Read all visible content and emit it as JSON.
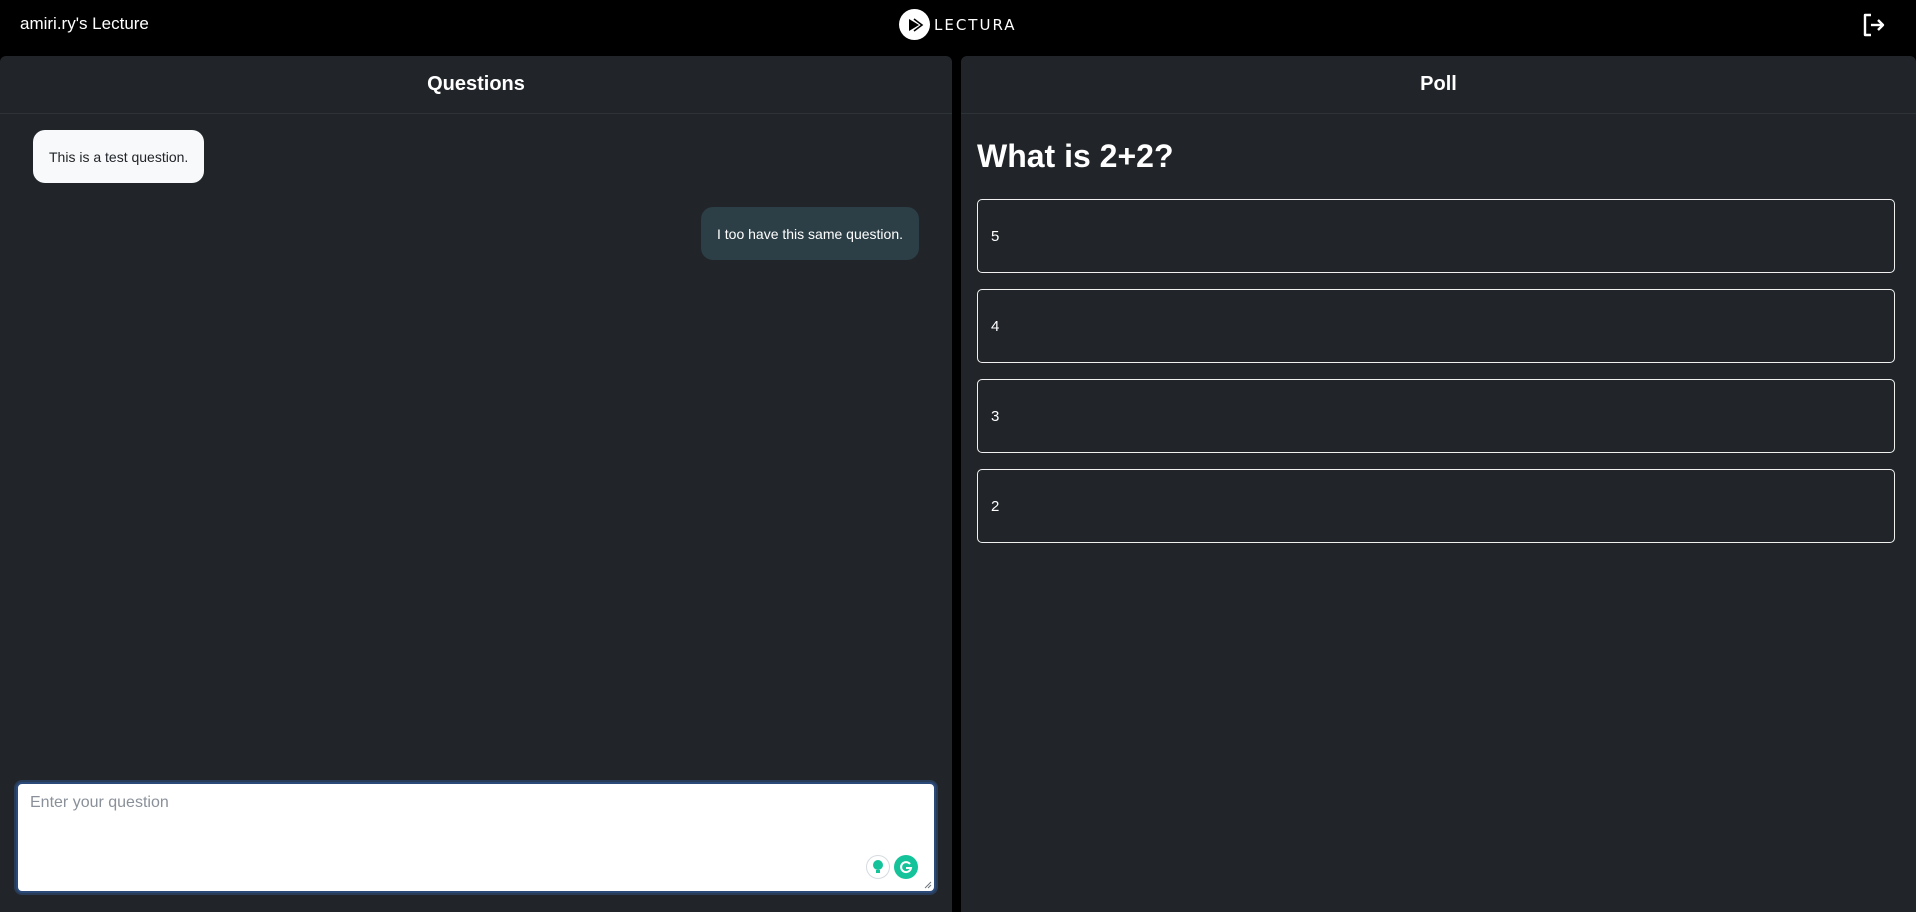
{
  "header": {
    "lecture_title": "amiri.ry's Lecture",
    "logo_text": "LECTURA",
    "logout_icon": "logout-icon"
  },
  "questions_panel": {
    "title": "Questions",
    "messages": [
      {
        "text": "This is a test question.",
        "side": "left"
      },
      {
        "text": "I too have this same question.",
        "side": "right"
      }
    ],
    "input": {
      "placeholder": "Enter your question",
      "value": ""
    },
    "tool_icons": [
      "lightbulb-icon",
      "grammarly-icon"
    ]
  },
  "poll_panel": {
    "title": "Poll",
    "question": "What is 2+2?",
    "options": [
      "5",
      "4",
      "3",
      "2"
    ]
  },
  "colors": {
    "background": "#000000",
    "panel": "#212529",
    "incoming_bubble": "#f8f9fa",
    "outgoing_bubble": "#2c3e46",
    "grammarly": "#15c39a"
  }
}
